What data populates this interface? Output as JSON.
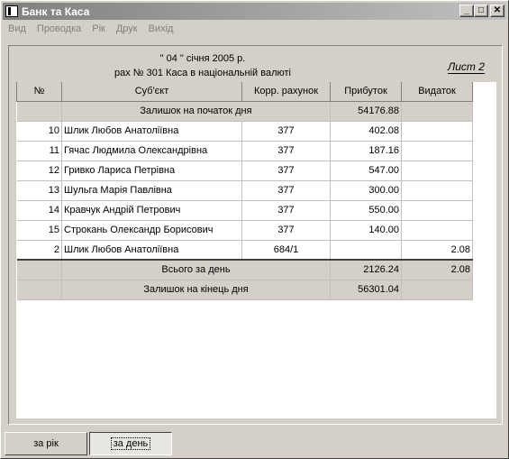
{
  "window": {
    "title": "Банк та Каса"
  },
  "menu": [
    "Вид",
    "Проводка",
    "Рік",
    "Друк",
    "Вихід"
  ],
  "report": {
    "date_line": "\" 04 \" січня 2005 р.",
    "account_line": "рах № 301 Каса в національній валюті",
    "sheet_label": "Лист 2"
  },
  "table": {
    "headers": [
      "№",
      "Суб'єкт",
      "Корр. рахунок",
      "Прибуток",
      "Видаток"
    ],
    "opening": {
      "label": "Залишок на початок дня",
      "income": "54176.88"
    },
    "rows": [
      {
        "num": "10",
        "subject": "Шлик Любов Анатоліївна",
        "account": "377",
        "income": "402.08",
        "expense": ""
      },
      {
        "num": "11",
        "subject": "Гячас Людмила Олександрівна",
        "account": "377",
        "income": "187.16",
        "expense": ""
      },
      {
        "num": "12",
        "subject": "Гривко Лариса Петрівна",
        "account": "377",
        "income": "547.00",
        "expense": ""
      },
      {
        "num": "13",
        "subject": "Шульга Марія Павлівна",
        "account": "377",
        "income": "300.00",
        "expense": ""
      },
      {
        "num": "14",
        "subject": "Кравчук Андрій Петрович",
        "account": "377",
        "income": "550.00",
        "expense": ""
      },
      {
        "num": "15",
        "subject": "Строкань Олександр Борисович",
        "account": "377",
        "income": "140.00",
        "expense": ""
      },
      {
        "num": "2",
        "subject": "Шлик Любов Анатоліївна",
        "account": "684/1",
        "income": "",
        "expense": "2.08"
      }
    ],
    "total": {
      "label": "Всього за день",
      "income": "2126.24",
      "expense": "2.08"
    },
    "closing": {
      "label": "Залишок на кінець дня",
      "income": "56301.04"
    }
  },
  "tabs": {
    "year": "за рік",
    "day": "за день"
  }
}
